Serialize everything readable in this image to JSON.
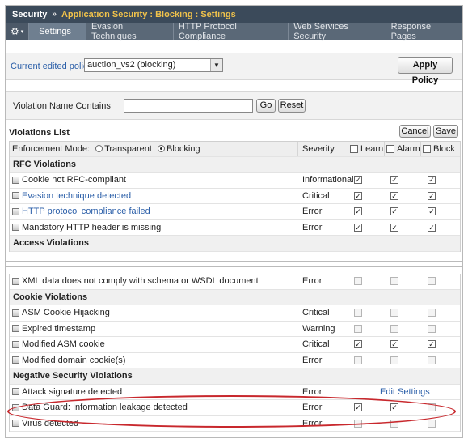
{
  "breadcrumb": {
    "root": "Security",
    "separator": "»",
    "path": "Application Security : Blocking : Settings"
  },
  "tabs": [
    "Settings",
    "Evasion Techniques",
    "HTTP Protocol Compliance",
    "Web Services Security",
    "Response Pages"
  ],
  "policy": {
    "label": "Current edited policy",
    "selected": "auction_vs2 (blocking)",
    "apply_label": "Apply Policy"
  },
  "filter": {
    "label": "Violation Name Contains",
    "value": "",
    "go_label": "Go",
    "reset_label": "Reset"
  },
  "list": {
    "title": "Violations List",
    "cancel_label": "Cancel",
    "save_label": "Save",
    "enforcement_label": "Enforcement Mode:",
    "mode_transparent": "Transparent",
    "mode_blocking": "Blocking",
    "col_severity": "Severity",
    "col_learn": "Learn",
    "col_alarm": "Alarm",
    "col_block": "Block"
  },
  "top_rows": [
    {
      "type": "section",
      "name": "RFC Violations"
    },
    {
      "type": "row",
      "name": "Cookie not RFC-compliant",
      "link": false,
      "severity": "Informational",
      "learn": true,
      "alarm": true,
      "block": true
    },
    {
      "type": "row",
      "name": "Evasion technique detected",
      "link": true,
      "severity": "Critical",
      "learn": true,
      "alarm": true,
      "block": true
    },
    {
      "type": "row",
      "name": "HTTP protocol compliance failed",
      "link": true,
      "severity": "Error",
      "learn": true,
      "alarm": true,
      "block": true
    },
    {
      "type": "row",
      "name": "Mandatory HTTP header is missing",
      "link": false,
      "severity": "Error",
      "learn": true,
      "alarm": true,
      "block": true
    },
    {
      "type": "section",
      "name": "Access Violations"
    }
  ],
  "bottom_rows": [
    {
      "type": "row",
      "name": "XML data does not comply with schema or WSDL document",
      "link": false,
      "severity": "Error",
      "learn": false,
      "alarm": false,
      "block": false
    },
    {
      "type": "section",
      "name": "Cookie Violations"
    },
    {
      "type": "row",
      "name": "ASM Cookie Hijacking",
      "link": false,
      "severity": "Critical",
      "learn": false,
      "alarm": false,
      "block": false
    },
    {
      "type": "row",
      "name": "Expired timestamp",
      "link": false,
      "severity": "Warning",
      "learn": false,
      "alarm": false,
      "block": false
    },
    {
      "type": "row",
      "name": "Modified ASM cookie",
      "link": false,
      "severity": "Critical",
      "learn": true,
      "alarm": true,
      "block": true
    },
    {
      "type": "row",
      "name": "Modified domain cookie(s)",
      "link": false,
      "severity": "Error",
      "learn": false,
      "alarm": false,
      "block": false
    },
    {
      "type": "section",
      "name": "Negative Security Violations"
    },
    {
      "type": "row",
      "name": "Attack signature detected",
      "link": false,
      "severity": "Error",
      "learn": null,
      "alarm": null,
      "block": null,
      "extra_link": "Edit Settings"
    },
    {
      "type": "row",
      "name": "Data Guard: Information leakage detected",
      "link": false,
      "severity": "Error",
      "learn": true,
      "alarm": true,
      "block": false
    },
    {
      "type": "row",
      "name": "Virus detected",
      "link": false,
      "severity": "Error",
      "learn": false,
      "alarm": false,
      "block": false
    }
  ],
  "colors": {
    "header_bg": "#3b4a5a",
    "path_text": "#f0c24b",
    "link": "#2a5ea8",
    "highlight_circle": "#c8282d"
  }
}
